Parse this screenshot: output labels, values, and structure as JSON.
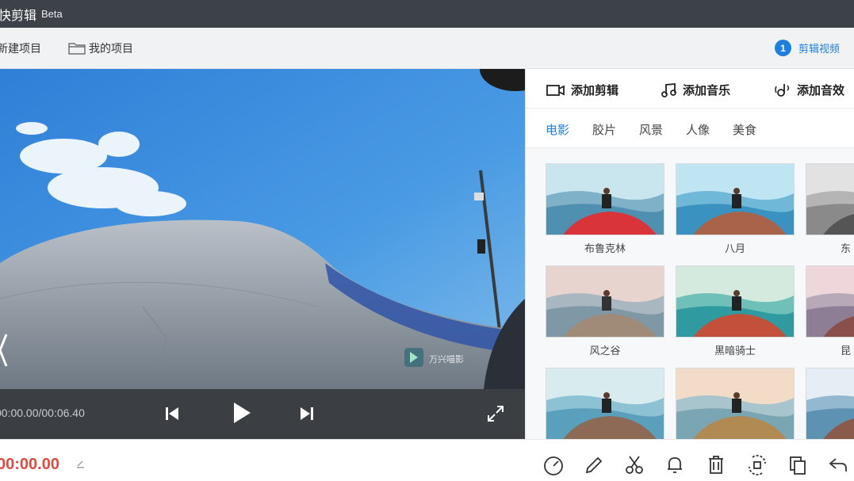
{
  "app": {
    "name": "快剪辑",
    "badge": "Beta"
  },
  "toolbar": {
    "new_project": "新建项目",
    "my_projects": "我的项目",
    "step_number": "1",
    "step_label": "剪辑视频"
  },
  "preview": {
    "watermark": "万兴喵影"
  },
  "controls": {
    "time": "00:00.00/00:06.40"
  },
  "panel": {
    "tabs": [
      "添加剪辑",
      "添加音乐",
      "添加音效"
    ],
    "categories": [
      "电影",
      "胶片",
      "风景",
      "人像",
      "美食"
    ],
    "active_category": "电影",
    "filters": [
      {
        "label": "布鲁克林"
      },
      {
        "label": "八月"
      },
      {
        "label": "东"
      },
      {
        "label": "风之谷"
      },
      {
        "label": "黑暗骑士"
      },
      {
        "label": "昆"
      },
      {
        "label": ""
      },
      {
        "label": ""
      },
      {
        "label": ""
      }
    ]
  },
  "bottombar": {
    "current_time": "00:00.00"
  },
  "colors": {
    "accent": "#1d7fe0",
    "time": "#e04a3f",
    "titlebar": "#3d4148"
  }
}
